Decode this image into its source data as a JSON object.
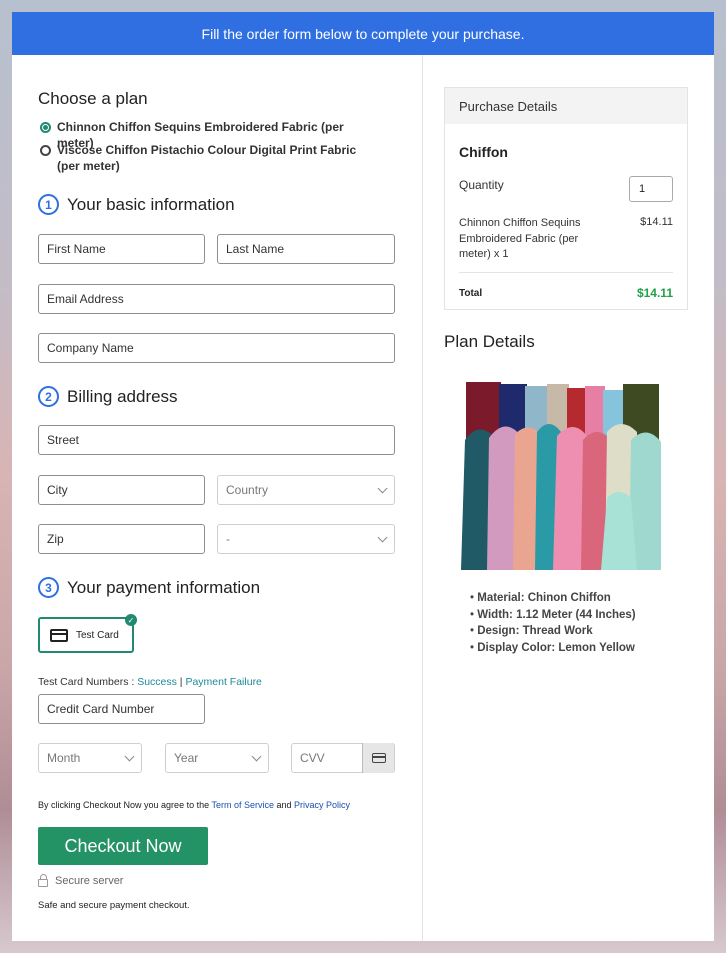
{
  "banner": {
    "text": "Fill the order form below to complete your purchase."
  },
  "plan": {
    "heading": "Choose a plan",
    "options": [
      {
        "label": "Chinnon Chiffon Sequins Embroidered Fabric (per meter)",
        "selected": true
      },
      {
        "label": "Viscose Chiffon Pistachio Colour Digital Print Fabric (per meter)",
        "selected": false
      }
    ]
  },
  "basic": {
    "num": "1",
    "heading": "Your basic information",
    "first_name": "First Name",
    "last_name": "Last Name",
    "email": "Email Address",
    "company": "Company Name"
  },
  "billing": {
    "num": "2",
    "heading": "Billing address",
    "street": "Street",
    "city": "City",
    "country": "Country",
    "zip": "Zip",
    "state": "-"
  },
  "payment": {
    "num": "3",
    "heading": "Your payment information",
    "test_card": "Test Card",
    "test_numbers_label": "Test Card Numbers : ",
    "success": "Success",
    "separator": " | ",
    "failure": "Payment Failure",
    "card_number": "Credit Card Number",
    "month": "Month",
    "year": "Year",
    "cvv": "CVV"
  },
  "terms": {
    "prefix": "By clicking Checkout Now you agree to the ",
    "tos": "Term of Service",
    "and": " and ",
    "privacy": "Privacy Policy"
  },
  "checkout": {
    "label": "Checkout Now",
    "secure": "Secure server",
    "safe": "Safe and secure payment checkout."
  },
  "purchase": {
    "header": "Purchase Details",
    "title": "Chiffon",
    "quantity_label": "Quantity",
    "quantity": "1",
    "item_desc": "Chinnon Chiffon Sequins Embroidered Fabric (per meter) x 1",
    "item_price": "$14.11",
    "total_label": "Total",
    "total": "$14.11"
  },
  "plan_details": {
    "heading": "Plan Details",
    "bullets": [
      "Material: Chinon Chiffon",
      "Width: 1.12 Meter (44 Inches)",
      "Design: Thread Work",
      "Display Color: Lemon Yellow"
    ]
  },
  "colors": {
    "accent": "#2f6fe2",
    "green": "#239264",
    "total": "#22a04a",
    "link": "#1e8a9a"
  },
  "icons": [
    "card-icon",
    "check-icon",
    "chevron-down-icon",
    "lock-icon"
  ]
}
